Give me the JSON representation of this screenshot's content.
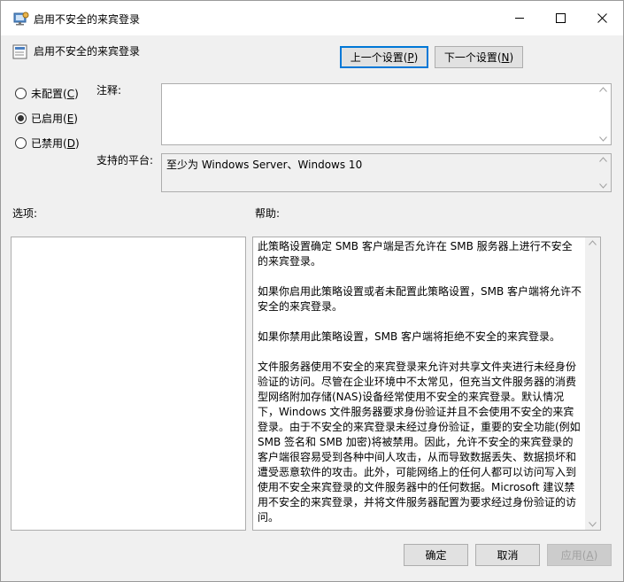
{
  "window": {
    "title": "启用不安全的来宾登录"
  },
  "policy": {
    "name": "启用不安全的来宾登录"
  },
  "nav": {
    "prev_label": "上一个设置(",
    "prev_key": "P",
    "next_label": "下一个设置(",
    "next_key": "N",
    "close_paren": ")"
  },
  "state": {
    "options": [
      {
        "label": "未配置(",
        "key": "C",
        "checked": false
      },
      {
        "label": "已启用(",
        "key": "E",
        "checked": true
      },
      {
        "label": "已禁用(",
        "key": "D",
        "checked": false
      }
    ]
  },
  "comment": {
    "label": "注释:",
    "value": ""
  },
  "platform": {
    "label": "支持的平台:",
    "value": "至少为 Windows Server、Windows 10"
  },
  "sections": {
    "options_label": "选项:",
    "help_label": "帮助:"
  },
  "help": {
    "paragraphs": [
      "此策略设置确定 SMB 客户端是否允许在 SMB 服务器上进行不安全的来宾登录。",
      "如果你启用此策略设置或者未配置此策略设置，SMB 客户端将允许不安全的来宾登录。",
      "如果你禁用此策略设置，SMB 客户端将拒绝不安全的来宾登录。",
      "文件服务器使用不安全的来宾登录来允许对共享文件夹进行未经身份验证的访问。尽管在企业环境中不太常见，但充当文件服务器的消费型网络附加存储(NAS)设备经常使用不安全的来宾登录。默认情况下，Windows 文件服务器要求身份验证并且不会使用不安全的来宾登录。由于不安全的来宾登录未经过身份验证，重要的安全功能(例如 SMB 签名和 SMB 加密)将被禁用。因此，允许不安全的来宾登录的客户端很容易受到各种中间人攻击，从而导致数据丢失、数据损坏和遭受恶意软件的攻击。此外，可能网络上的任何人都可以访问写入到使用不安全来宾登录的文件服务器中的任何数据。Microsoft 建议禁用不安全的来宾登录，并将文件服务器配置为要求经过身份验证的访问。"
    ]
  },
  "footer": {
    "ok_label": "确定",
    "cancel_label": "取消",
    "apply_label": "应用(",
    "apply_key": "A"
  }
}
